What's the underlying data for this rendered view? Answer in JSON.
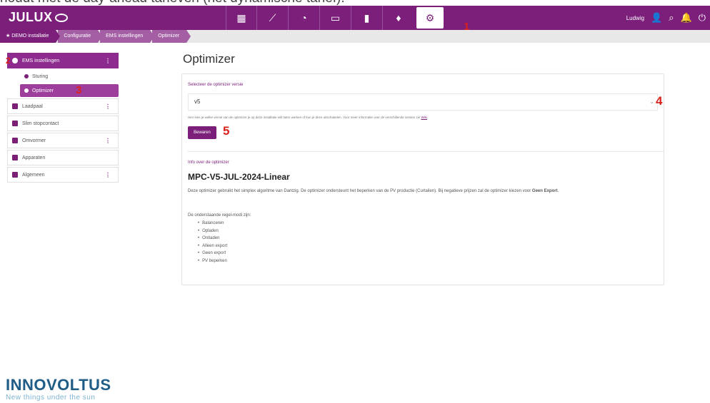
{
  "caption": "houdt met de day-ahead tarieven (het dynamische tarief).",
  "topbar": {
    "logo": "JULUX",
    "user": "Ludwig",
    "nav_icons": [
      "dashboard-icon",
      "chart-icon",
      "meter-icon",
      "battery-module-icon",
      "battery-icon",
      "plug-icon",
      "gear-icon"
    ]
  },
  "breadcrumb": [
    "DEMO installatie",
    "Configuratie",
    "EMS instellingen",
    "Optimizer"
  ],
  "sidebar": {
    "items": [
      {
        "label": "EMS instellingen",
        "sub": [
          {
            "label": "Sturing"
          },
          {
            "label": "Optimizer"
          }
        ]
      },
      {
        "label": "Laadpaal"
      },
      {
        "label": "Slim stopcontact"
      },
      {
        "label": "Omvormer"
      },
      {
        "label": "Apparaten"
      },
      {
        "label": "Algemeen"
      }
    ]
  },
  "main": {
    "title": "Optimizer",
    "version_label": "Selecteer de optimizer versie",
    "version_value": "v5",
    "help_text": "Hier kies je welke versie van de optimizer je op deze installatie wilt laten werken of kun je deze uitschakelen. Voor meer informatie over de verschillende versies zie",
    "help_link": "Wiki",
    "save_label": "Bewaren",
    "info_label": "Info over de optimizer",
    "algo_title": "MPC-V5-JUL-2024-Linear",
    "description_1": "Deze optimizer gebruikt het simplex algoritme van Dantzig. De optimizer ondersteunt het beperken van de PV productie (Curtailen). Bij negatieve prijzen zal de optimizer kiezen voor",
    "description_bold": "Geen Export",
    "modes_intro": "De onderstaande regel-modi zijn:",
    "modes": [
      "Balanceren",
      "Opladen",
      "Ontladen",
      "Alleen export",
      "Geen export",
      "PV beperken"
    ]
  },
  "annotations": [
    "1",
    "2",
    "3",
    "4",
    "5"
  ],
  "brand": {
    "name": "INNOVOLTUS",
    "tagline": "New things under the sun"
  },
  "colors": {
    "brand": "#7b1f7b",
    "annotation": "#d9221c",
    "logo": "#1f5c86"
  }
}
